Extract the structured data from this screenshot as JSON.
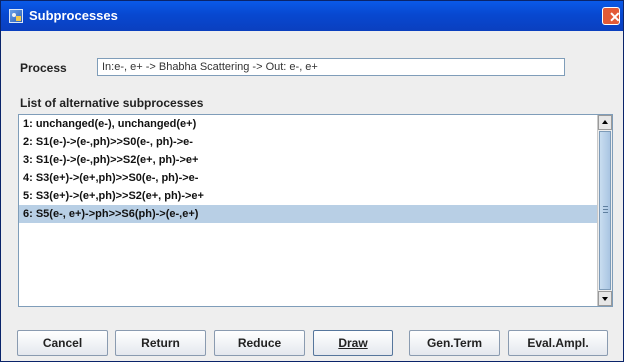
{
  "window": {
    "title": "Subprocesses",
    "close_glyph": "✕"
  },
  "process": {
    "label": "Process",
    "value": "In:e-, e+  -> Bhabha Scattering -> Out: e-, e+"
  },
  "list": {
    "heading": "List of alternative subprocesses",
    "items": [
      "1:  unchanged(e-), unchanged(e+)",
      "2: S1(e-)->(e-,ph)>>S0(e-, ph)->e-",
      "3: S1(e-)->(e-,ph)>>S2(e+, ph)->e+",
      "4: S3(e+)->(e+,ph)>>S0(e-, ph)->e-",
      "5: S3(e+)->(e+,ph)>>S2(e+, ph)->e+",
      "6: S5(e-, e+)->ph>>S6(ph)->(e-,e+)"
    ],
    "selected_index": 5
  },
  "buttons": {
    "cancel": "Cancel",
    "return": "Return",
    "reduce": "Reduce",
    "draw": "Draw",
    "gen_term": "Gen.Term",
    "eval_ampl": "Eval.Ampl."
  },
  "colors": {
    "titlebar": "#0a4fd6",
    "selection": "#b8cfe5",
    "close_button": "#e35a37"
  },
  "icons": {
    "app": "java-app-icon",
    "close": "close-icon",
    "scroll_up": "arrow-up-icon",
    "scroll_down": "arrow-down-icon"
  }
}
